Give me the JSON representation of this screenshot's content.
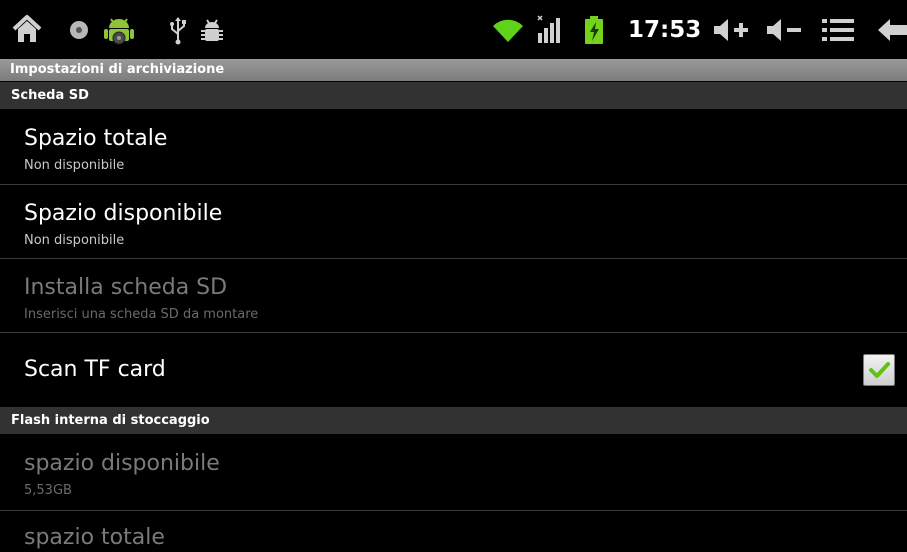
{
  "status_bar": {
    "clock": "17:53",
    "left_icons": [
      "home-icon",
      "notification-dot-icon",
      "android-mascot-icon",
      "usb-icon",
      "debug-bug-icon"
    ],
    "right_icons": [
      "wifi-icon",
      "signal-icon",
      "battery-charging-icon",
      "volume-up-icon",
      "volume-down-icon",
      "menu-icon",
      "back-icon"
    ]
  },
  "screen_title": "Impostazioni di archiviazione",
  "sd_section": {
    "header": "Scheda SD",
    "items": [
      {
        "title": "Spazio totale",
        "summary": "Non disponibile",
        "enabled": true
      },
      {
        "title": "Spazio disponibile",
        "summary": "Non disponibile",
        "enabled": true
      },
      {
        "title": "Installa scheda SD",
        "summary": "Inserisci una scheda SD da montare",
        "enabled": false
      }
    ],
    "scan": {
      "title": "Scan TF card",
      "checked": true
    }
  },
  "flash_section": {
    "header": "Flash interna di stoccaggio",
    "items": [
      {
        "title": "spazio disponibile",
        "summary": "5,53GB",
        "enabled": false
      },
      {
        "title": "spazio totale",
        "summary": "",
        "enabled": false
      }
    ]
  },
  "colors": {
    "background": "#000000",
    "check_accent": "#5fc314",
    "wifi": "#5fd31a",
    "battery": "#74d21c"
  }
}
